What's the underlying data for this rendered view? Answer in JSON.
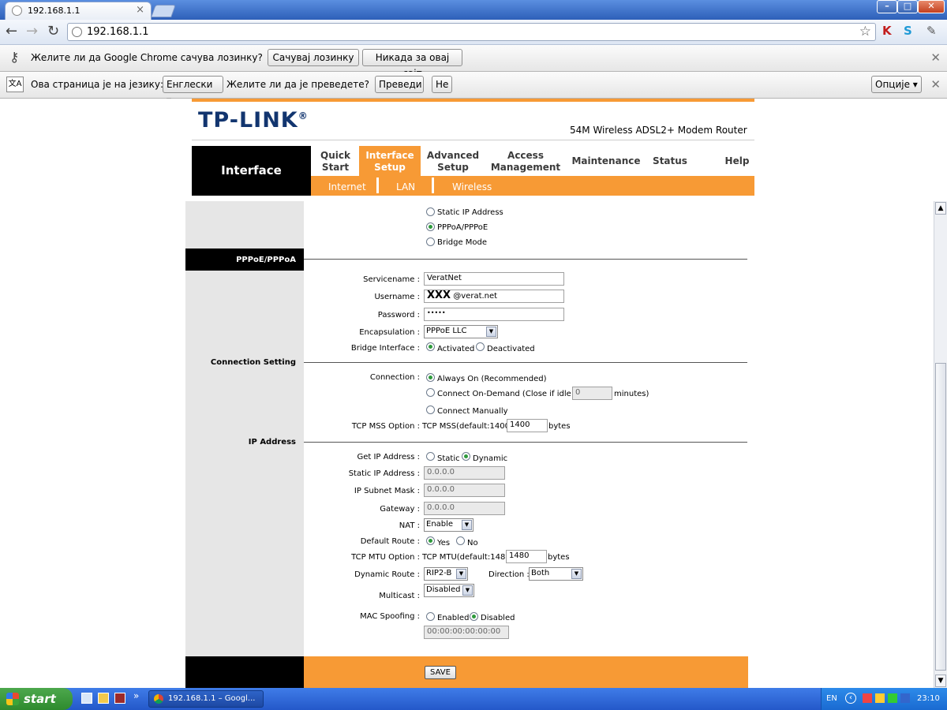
{
  "browser": {
    "tab_title": "192.168.1.1",
    "url": "192.168.1.1",
    "window_buttons": {
      "minimize": "–",
      "maximize": "□",
      "close": "✕"
    }
  },
  "password_bar": {
    "question": "Желите ли да Google Chrome сачува лозинку?",
    "save_button": "Сачувај лозинку",
    "never_button": "Никада за овај сајт"
  },
  "translate_bar": {
    "prefix": "Ова страница је на језику:",
    "language": "Енглески",
    "question": "Желите ли да је преведете?",
    "translate_button": "Преведи",
    "no_button": "Не",
    "options_button": "Опције"
  },
  "router": {
    "brand": "TP-LINK",
    "model": "54M Wireless ADSL2+ Modem Router",
    "current_section": "Interface",
    "nav": [
      {
        "line1": "Quick",
        "line2": "Start"
      },
      {
        "line1": "Interface",
        "line2": "Setup"
      },
      {
        "line1": "Advanced",
        "line2": "Setup"
      },
      {
        "line1": "Access",
        "line2": "Management"
      },
      {
        "line1": "Maintenance",
        "line2": ""
      },
      {
        "line1": "Status",
        "line2": ""
      },
      {
        "line1": "Help",
        "line2": ""
      }
    ],
    "subnav": [
      "Internet",
      "LAN",
      "Wireless"
    ],
    "isp_options": [
      "Static IP Address",
      "PPPoA/PPPoE",
      "Bridge Mode"
    ],
    "sections": {
      "pppoe": "PPPoE/PPPoA",
      "connection": "Connection Setting",
      "ip": "IP Address"
    },
    "fields": {
      "servicename_label": "Servicename :",
      "servicename_value": "VeratNet",
      "username_label": "Username :",
      "username_value_bold": "XXX",
      "username_value": "@verat.net",
      "password_label": "Password :",
      "password_value": "•••••",
      "encapsulation_label": "Encapsulation :",
      "encapsulation_value": "PPPoE LLC",
      "bridge_label": "Bridge Interface :",
      "bridge_activated": "Activated",
      "bridge_deactivated": "Deactivated",
      "connection_label": "Connection :",
      "conn_always": "Always On (Recommended)",
      "conn_ondemand": "Connect On-Demand (Close if idle for",
      "conn_idle_value": "0",
      "conn_minutes": "minutes)",
      "conn_manual": "Connect Manually",
      "tcpmss_label": "TCP MSS Option :",
      "tcpmss_text": "TCP MSS(default:1400)",
      "tcpmss_value": "1400",
      "tcpmss_unit": "bytes",
      "getip_label": "Get IP Address :",
      "getip_static": "Static",
      "getip_dynamic": "Dynamic",
      "staticip_label": "Static IP Address :",
      "staticip_value": "0.0.0.0",
      "subnet_label": "IP Subnet Mask :",
      "subnet_value": "0.0.0.0",
      "gateway_label": "Gateway :",
      "gateway_value": "0.0.0.0",
      "nat_label": "NAT :",
      "nat_value": "Enable",
      "defroute_label": "Default Route :",
      "defroute_yes": "Yes",
      "defroute_no": "No",
      "tcpmtu_label": "TCP MTU Option :",
      "tcpmtu_text": "TCP MTU(default:1480)",
      "tcpmtu_value": "1480",
      "tcpmtu_unit": "bytes",
      "dynroute_label": "Dynamic Route :",
      "dynroute_value": "RIP2-B",
      "direction_label": "Direction :",
      "direction_value": "Both",
      "multicast_label": "Multicast :",
      "multicast_value": "Disabled",
      "mac_label": "MAC Spoofing :",
      "mac_enabled": "Enabled",
      "mac_disabled": "Disabled",
      "mac_value": "00:00:00:00:00:00"
    },
    "save_button": "SAVE"
  },
  "taskbar": {
    "start": "start",
    "task_item": "192.168.1.1 – Googl...",
    "language": "EN",
    "clock": "23:10",
    "chevron": "»"
  }
}
